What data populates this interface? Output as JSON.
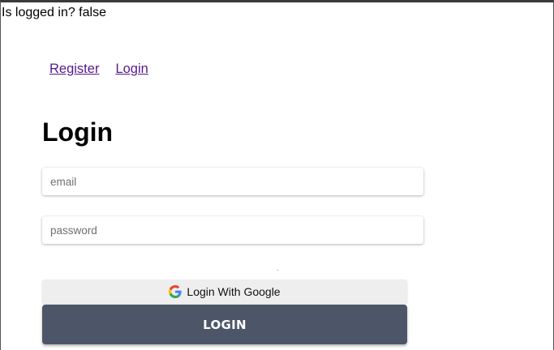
{
  "status": {
    "text": "Is logged in? false"
  },
  "nav": {
    "register_label": "Register",
    "login_label": "Login"
  },
  "form": {
    "title": "Login",
    "email_placeholder": "email",
    "email_value": "",
    "password_placeholder": "password",
    "password_value": "",
    "google_button_label": "Login With Google",
    "submit_label": "LOGIN",
    "google_icon": "google-g-icon"
  },
  "colors": {
    "link": "#551a8b",
    "submit_bg": "#4d5568",
    "google_bg": "#eeeeee"
  }
}
